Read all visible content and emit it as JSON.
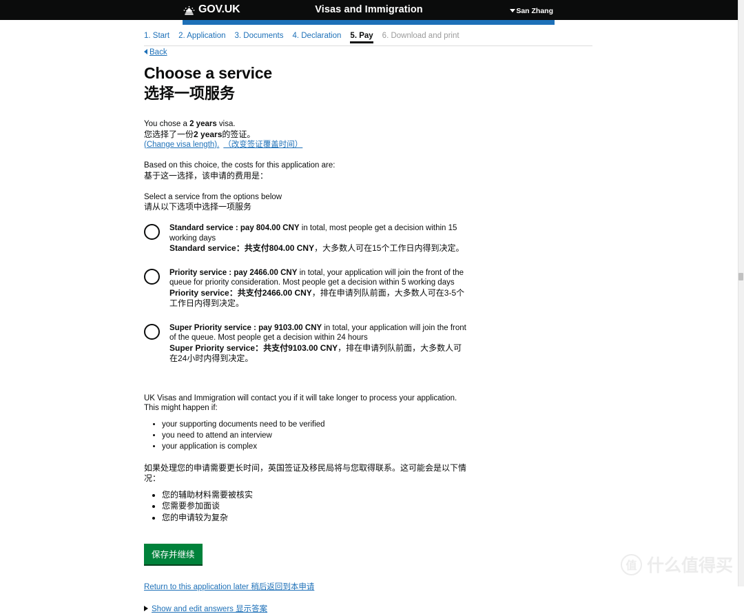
{
  "header": {
    "brand": "GOV.UK",
    "crown_icon": "crown-icon",
    "service_name": "Visas and Immigration",
    "account_name": "San Zhang",
    "caret_icon": "chevron-down-icon"
  },
  "progress_steps": [
    {
      "label": "1. Start",
      "state": "link"
    },
    {
      "label": "2. Application",
      "state": "link"
    },
    {
      "label": "3. Documents",
      "state": "link"
    },
    {
      "label": "4. Declaration",
      "state": "link"
    },
    {
      "label": "5. Pay",
      "state": "current"
    },
    {
      "label": "6. Download and print",
      "state": "disabled"
    }
  ],
  "back": {
    "label": "Back",
    "icon": "triangle-left-icon"
  },
  "main": {
    "title_en": "Choose a service",
    "title_zh": "选择一项服务",
    "chose_en_pre": "You chose a ",
    "chose_en_bold": "2 years",
    "chose_en_post": " visa.",
    "chose_zh_pre": "您选择了一份",
    "chose_zh_bold": "2 years",
    "chose_zh_post": "的签证。",
    "change_link_en": "(Change visa length).",
    "change_link_zh": "（改变签证覆盖时间）",
    "costs_en": "Based on this choice, the costs for this application are:",
    "costs_zh": "基于这一选择，该申请的费用是：",
    "select_en": "Select a service from the options below",
    "select_zh": "请从以下选项中选择一项服务"
  },
  "services": [
    {
      "id": "standard",
      "en_bold": "Standard service : pay 804.00 CNY",
      "en_rest": " in total, most people get a decision within 15 working days",
      "zh_lead": "Standard service：",
      "zh_bold": "共支付804.00 CNY",
      "zh_rest": "，大多数人可在15个工作日内得到决定。",
      "selected": false
    },
    {
      "id": "priority",
      "en_bold": "Priority service : pay 2466.00 CNY",
      "en_rest": " in total, your application will join the front of the queue for priority consideration. Most people get a decision within 5 working days",
      "zh_lead": "Priority service：",
      "zh_bold": "共支付2466.00 CNY",
      "zh_rest": "，排在申请列队前面，大多数人可在3-5个工作日内得到决定。",
      "selected": false
    },
    {
      "id": "super-priority",
      "en_bold": "Super Priority service : pay 9103.00 CNY",
      "en_rest": " in total, your application will join the front of the queue. Most people get a decision within 24 hours",
      "zh_lead": "Super Priority service：",
      "zh_bold": "共支付9103.00 CNY",
      "zh_rest": "，排在申请列队前面，大多数人可在24小时内得到决定。",
      "selected": false
    }
  ],
  "notice": {
    "en_intro": "UK Visas and Immigration will contact you if it will take longer to process your application. This might happen if:",
    "en_items": [
      "your supporting documents need to be verified",
      "you need to attend an interview",
      "your application is complex"
    ],
    "zh_intro": "如果处理您的申请需要更长时间，英国签证及移民局将与您取得联系。这可能会是以下情况：",
    "zh_items": [
      "您的辅助材料需要被核实",
      "您需要参加面谈",
      "您的申请较为复杂"
    ]
  },
  "actions": {
    "save_button": "保存并继续",
    "return_link": "Return to this application later 稍后返回到本申请",
    "show_answers": "Show and edit answers 显示答案",
    "disclosure_icon": "triangle-right-icon"
  },
  "watermark": {
    "badge": "值",
    "text": "什么值得买"
  },
  "colors": {
    "header_bg": "#0b0c0c",
    "accent_blue": "#1d70b8",
    "link_blue": "#1d70b8",
    "button_green": "#00823b",
    "disabled_grey": "#9a9a9a"
  }
}
